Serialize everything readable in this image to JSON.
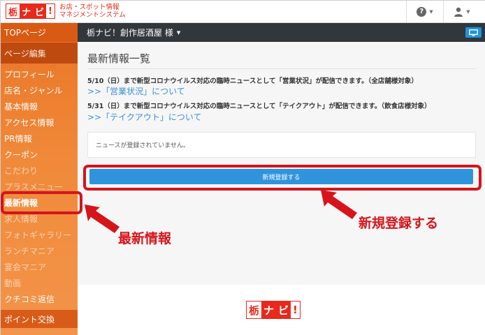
{
  "header": {
    "logo_parts": [
      "栃",
      "ナ",
      "ビ",
      "!"
    ],
    "brand_line1": "お店・スポット情報",
    "brand_line2": "マネジメントシステム",
    "help_icon": "question-circle-icon",
    "user_icon": "user-icon"
  },
  "sidebar": {
    "top": "TOPページ",
    "section": "ページ編集",
    "items": [
      {
        "label": "プロフィール"
      },
      {
        "label": "店名・ジャンル"
      },
      {
        "label": "基本情報"
      },
      {
        "label": "アクセス情報"
      },
      {
        "label": "PR情報"
      },
      {
        "label": "クーポン"
      },
      {
        "label": "こだわり"
      },
      {
        "label": "プラスメニュー"
      },
      {
        "label": "最新情報"
      },
      {
        "label": "求人情報"
      },
      {
        "label": "フォトギャラリー"
      },
      {
        "label": "ランチマニア"
      },
      {
        "label": "宴会マニア"
      },
      {
        "label": "動画"
      },
      {
        "label": "クチコミ返信"
      }
    ],
    "bottom": "ポイント交換"
  },
  "subbar": {
    "shop_name": "栃ナビ！創作居酒屋 様",
    "monitor_icon": "monitor-icon"
  },
  "main": {
    "title": "最新情報一覧",
    "notice1": "5/10（日）まで新型コロナウイルス対応の臨時ニュースとして「営業状況」が配信できます。（全店舗様対象）",
    "link1": ">>「営業状況」について",
    "notice2": "5/31（日）まで新型コロナウイルス対応の臨時ニュースとして「テイクアウト」が配信できます。（飲食店様対象）",
    "link2": ">>「テイクアウト」について",
    "empty_message": "ニュースが登録されていません。",
    "new_button": "新規登録する"
  },
  "annotations": {
    "sidebar_callout": "最新情報",
    "button_callout": "新規登録する",
    "color": "#d6141b"
  }
}
